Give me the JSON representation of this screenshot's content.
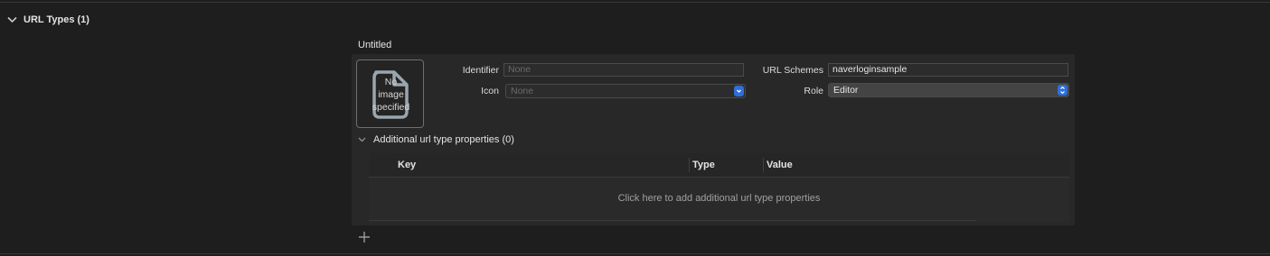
{
  "section": {
    "title": "URL Types (1)",
    "icon": "chevron-down-icon"
  },
  "entry": {
    "title": "Untitled",
    "image_placeholder_lines": [
      "No",
      "image",
      "specified"
    ],
    "identifier": {
      "label": "Identifier",
      "placeholder": "None",
      "value": ""
    },
    "icon": {
      "label": "Icon",
      "placeholder": "None"
    },
    "url_schemes": {
      "label": "URL Schemes",
      "value": "naverloginsample"
    },
    "role": {
      "label": "Role",
      "value": "Editor"
    }
  },
  "additional": {
    "title": "Additional url type properties (0)",
    "columns": [
      "Key",
      "Type",
      "Value"
    ],
    "empty_text": "Click here to add additional url type properties"
  },
  "toolbar": {
    "add_icon": "plus-icon"
  },
  "colors": {
    "accent": "#2e6fd8",
    "background": "#1e1e1e",
    "panel": "#282828"
  }
}
